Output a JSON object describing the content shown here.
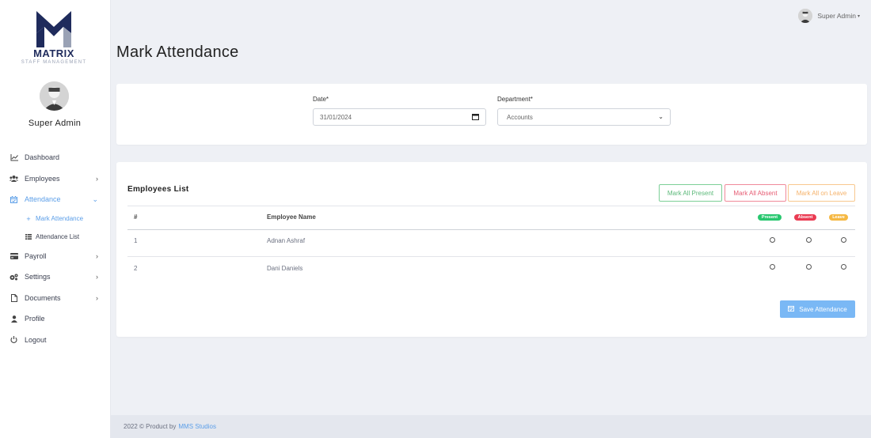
{
  "brand": {
    "name": "MATRIX",
    "tagline": "STAFF MANAGEMENT"
  },
  "user": {
    "name": "Super Admin",
    "top_name": "Super Admin"
  },
  "nav": [
    {
      "label": "Dashboard",
      "icon": "chart-line-icon"
    },
    {
      "label": "Employees",
      "icon": "users-icon",
      "has_children": true
    },
    {
      "label": "Attendance",
      "icon": "calendar-check-icon",
      "active": true,
      "expanded": true
    },
    {
      "label": "Mark Attendance",
      "icon": "plus-icon",
      "sub": true,
      "current": true
    },
    {
      "label": "Attendance List",
      "icon": "list-icon",
      "sub": true
    },
    {
      "label": "Payroll",
      "icon": "credit-card-icon",
      "has_children": true
    },
    {
      "label": "Settings",
      "icon": "cogs-icon",
      "has_children": true
    },
    {
      "label": "Documents",
      "icon": "file-icon",
      "has_children": true
    },
    {
      "label": "Profile",
      "icon": "user-icon"
    },
    {
      "label": "Logout",
      "icon": "power-icon"
    }
  ],
  "page": {
    "title": "Mark Attendance"
  },
  "filters": {
    "date_label": "Date*",
    "date_value": "31/01/2024",
    "department_label": "Department*",
    "department_value": "Accounts"
  },
  "employees": {
    "title": "Employees List",
    "mark_all_present": "Mark All Present",
    "mark_all_absent": "Mark All Absent",
    "mark_all_leave": "Mark All on Leave",
    "columns": {
      "index": "#",
      "name": "Employee Name",
      "present": "Present",
      "absent": "Absent",
      "leave": "Leave"
    },
    "rows": [
      {
        "index": "1",
        "name": "Adnan Ashraf"
      },
      {
        "index": "2",
        "name": "Dani Daniels"
      }
    ],
    "save_label": "Save Attendance"
  },
  "footer": {
    "text": "2022 © Product by",
    "link": "MMS Studios"
  },
  "colors": {
    "accent": "#5b9ee8",
    "present": "#28c76f",
    "absent": "#ea3c53",
    "leave": "#f5b843",
    "save": "#7ab8f5"
  }
}
